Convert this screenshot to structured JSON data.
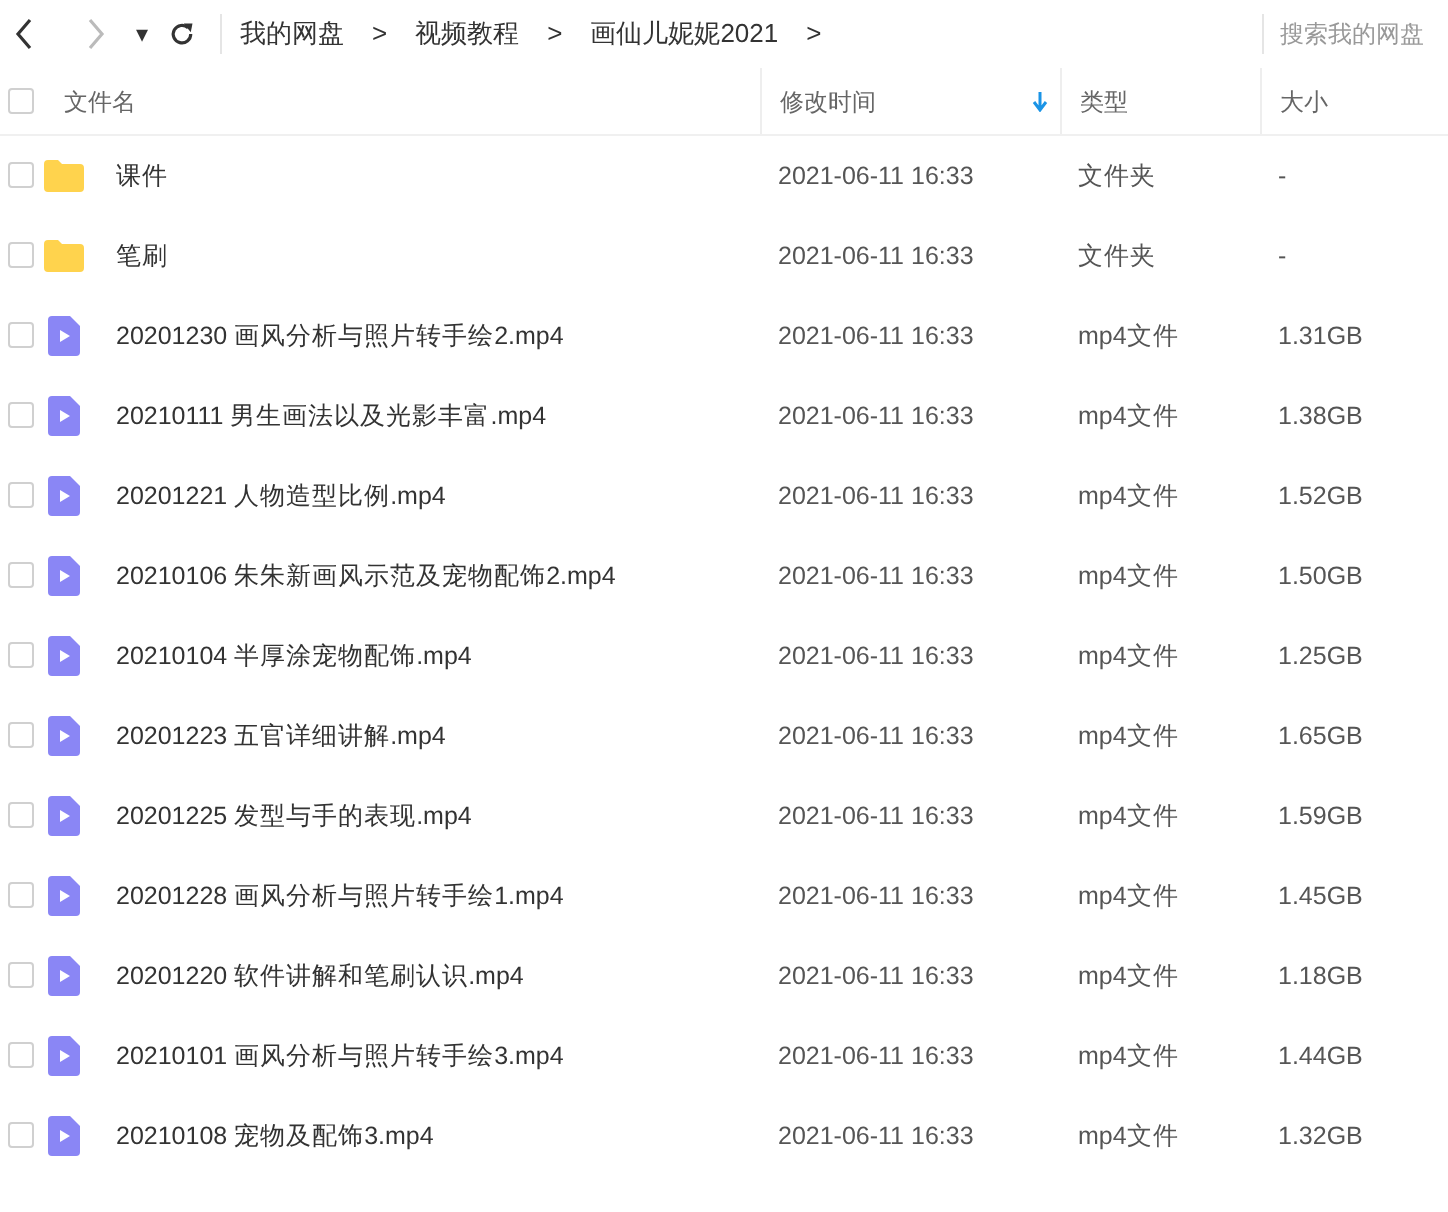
{
  "toolbar": {
    "dropdown": "▾",
    "breadcrumbs": [
      "我的网盘",
      "视频教程",
      "画仙儿妮妮2021"
    ],
    "separator": ">",
    "search": {
      "placeholder": "搜索我的网盘"
    }
  },
  "table": {
    "all_checked": false,
    "columns": [
      {
        "label": "文件名",
        "sorted": false
      },
      {
        "label": "修改时间",
        "sorted": true
      },
      {
        "label": "类型",
        "sorted": false
      },
      {
        "label": "大小",
        "sorted": false
      }
    ],
    "rows": [
      {
        "kind": "folder",
        "checked": false,
        "name": "课件",
        "modified": "2021-06-11 16:33",
        "type": "文件夹",
        "size": "-"
      },
      {
        "kind": "folder",
        "checked": false,
        "name": "笔刷",
        "modified": "2021-06-11 16:33",
        "type": "文件夹",
        "size": "-"
      },
      {
        "kind": "video",
        "checked": false,
        "name": "20201230 画风分析与照片转手绘2.mp4",
        "modified": "2021-06-11 16:33",
        "type": "mp4文件",
        "size": "1.31GB"
      },
      {
        "kind": "video",
        "checked": false,
        "name": "20210111 男生画法以及光影丰富.mp4",
        "modified": "2021-06-11 16:33",
        "type": "mp4文件",
        "size": "1.38GB"
      },
      {
        "kind": "video",
        "checked": false,
        "name": "20201221 人物造型比例.mp4",
        "modified": "2021-06-11 16:33",
        "type": "mp4文件",
        "size": "1.52GB"
      },
      {
        "kind": "video",
        "checked": false,
        "name": "20210106 朱朱新画风示范及宠物配饰2.mp4",
        "modified": "2021-06-11 16:33",
        "type": "mp4文件",
        "size": "1.50GB"
      },
      {
        "kind": "video",
        "checked": false,
        "name": "20210104 半厚涂宠物配饰.mp4",
        "modified": "2021-06-11 16:33",
        "type": "mp4文件",
        "size": "1.25GB"
      },
      {
        "kind": "video",
        "checked": false,
        "name": "20201223 五官详细讲解.mp4",
        "modified": "2021-06-11 16:33",
        "type": "mp4文件",
        "size": "1.65GB"
      },
      {
        "kind": "video",
        "checked": false,
        "name": "20201225 发型与手的表现.mp4",
        "modified": "2021-06-11 16:33",
        "type": "mp4文件",
        "size": "1.59GB"
      },
      {
        "kind": "video",
        "checked": false,
        "name": "20201228 画风分析与照片转手绘1.mp4",
        "modified": "2021-06-11 16:33",
        "type": "mp4文件",
        "size": "1.45GB"
      },
      {
        "kind": "video",
        "checked": false,
        "name": "20201220 软件讲解和笔刷认识.mp4",
        "modified": "2021-06-11 16:33",
        "type": "mp4文件",
        "size": "1.18GB"
      },
      {
        "kind": "video",
        "checked": false,
        "name": "20210101 画风分析与照片转手绘3.mp4",
        "modified": "2021-06-11 16:33",
        "type": "mp4文件",
        "size": "1.44GB"
      },
      {
        "kind": "video",
        "checked": false,
        "name": "20210108 宠物及配饰3.mp4",
        "modified": "2021-06-11 16:33",
        "type": "mp4文件",
        "size": "1.32GB"
      }
    ]
  }
}
